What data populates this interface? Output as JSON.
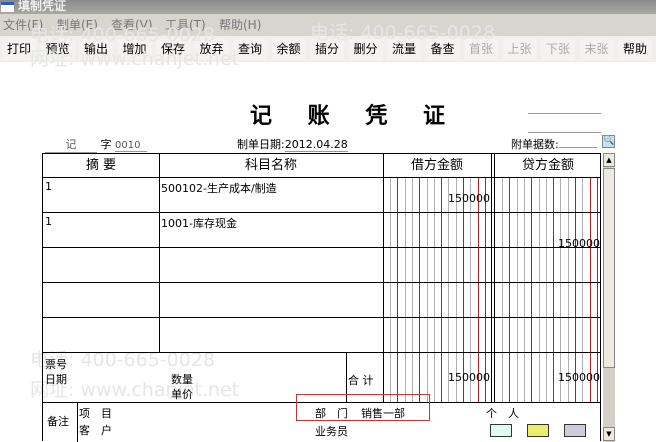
{
  "window": {
    "title": "填制凭证"
  },
  "menu": [
    "文件(F)",
    "制单(E)",
    "查看(V)",
    "工具(T)",
    "帮助(H)"
  ],
  "toolbar": [
    {
      "label": "打印",
      "enabled": true
    },
    {
      "label": "预览",
      "enabled": true
    },
    {
      "label": "输出",
      "enabled": true
    },
    {
      "label": "增加",
      "enabled": true
    },
    {
      "label": "保存",
      "enabled": true
    },
    {
      "label": "放弃",
      "enabled": true
    },
    {
      "label": "查询",
      "enabled": true
    },
    {
      "label": "余额",
      "enabled": true
    },
    {
      "label": "插分",
      "enabled": true
    },
    {
      "label": "删分",
      "enabled": true
    },
    {
      "label": "流量",
      "enabled": true
    },
    {
      "label": "备查",
      "enabled": true
    },
    {
      "label": "首张",
      "enabled": false
    },
    {
      "label": "上张",
      "enabled": false
    },
    {
      "label": "下张",
      "enabled": false
    },
    {
      "label": "末张",
      "enabled": false
    },
    {
      "label": "帮助",
      "enabled": true
    }
  ],
  "watermark": {
    "phone": "电话: 400-665-0028",
    "site": "网址: www.chanjet.net"
  },
  "voucher": {
    "title": "记 账 凭 证",
    "type": "记",
    "zi": "字",
    "number": "0010",
    "date_label": "制单日期:",
    "date": "2012.04.28",
    "attach_label": "附单据数:",
    "attach_value": "",
    "headers": {
      "summary": "摘 要",
      "account": "科目名称",
      "debit": "借方金额",
      "credit": "贷方金额"
    },
    "rows": [
      {
        "summary": "1",
        "account": "500102-生产成本/制造",
        "debit": "150000",
        "credit": ""
      },
      {
        "summary": "1",
        "account": "1001-库存现金",
        "debit": "",
        "credit": "150000"
      },
      {
        "summary": "",
        "account": "",
        "debit": "",
        "credit": ""
      },
      {
        "summary": "",
        "account": "",
        "debit": "",
        "credit": ""
      },
      {
        "summary": "",
        "account": "",
        "debit": "",
        "credit": ""
      }
    ],
    "footer": {
      "ticket_no": "票号",
      "date": "日期",
      "qty": "数量",
      "price": "单价",
      "total_label": "合 计",
      "debit_total": "150000",
      "credit_total": "150000"
    },
    "remarks": {
      "label": "备注",
      "project": "项　目",
      "customer": "客　户",
      "dept_label": "部　门",
      "dept_value": "销售一部",
      "person": "个　人",
      "salesman": "业务员"
    }
  },
  "colors": {
    "blue_line": "#4040a0",
    "red_line": "#c02020",
    "grid": "#b0b0b0"
  }
}
